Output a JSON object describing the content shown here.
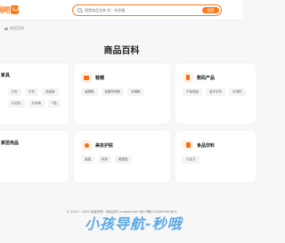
{
  "header": {
    "logo_text": "网吧",
    "search": {
      "placeholder": "搜索商品名称 如：伙伴猫",
      "button_label": "搜索"
    }
  },
  "breadcrumb": {
    "label": "商品百科"
  },
  "page_title": "商品百科",
  "categories": [
    {
      "title": "家具",
      "icon": "sofa-icon",
      "tags": [
        "衬衫",
        "外衣",
        "西装裤",
        "针织衫",
        "马甲裤",
        "T恤"
      ]
    },
    {
      "title": "鞋帽",
      "icon": "shirt-icon",
      "tags": [
        "高跟鞋",
        "高跟网球鞋",
        "多福鞋"
      ]
    },
    {
      "title": "数码产品",
      "icon": "phone-icon",
      "tags": [
        "平板电脑",
        "蓝牙手机",
        "对讲机"
      ]
    },
    {
      "title": "家居用品",
      "icon": "home-icon",
      "tags": []
    },
    {
      "title": "美妆护肤",
      "icon": "lipstick-icon",
      "tags": [
        "面霜",
        "粉底",
        "眼霜霜"
      ]
    },
    {
      "title": "食品饮料",
      "icon": "food-icon",
      "tags": [
        "巧克力"
      ]
    }
  ],
  "footer": {
    "text": "© 2023 - 2025 某省网吧 - 商品百科 ymgiz6.com 浙ICP备2025083490号-4"
  },
  "watermark": {
    "text": "小孩导航-秒哦"
  },
  "colors": {
    "accent": "#ff7a1a",
    "background": "#f7f7f8"
  }
}
